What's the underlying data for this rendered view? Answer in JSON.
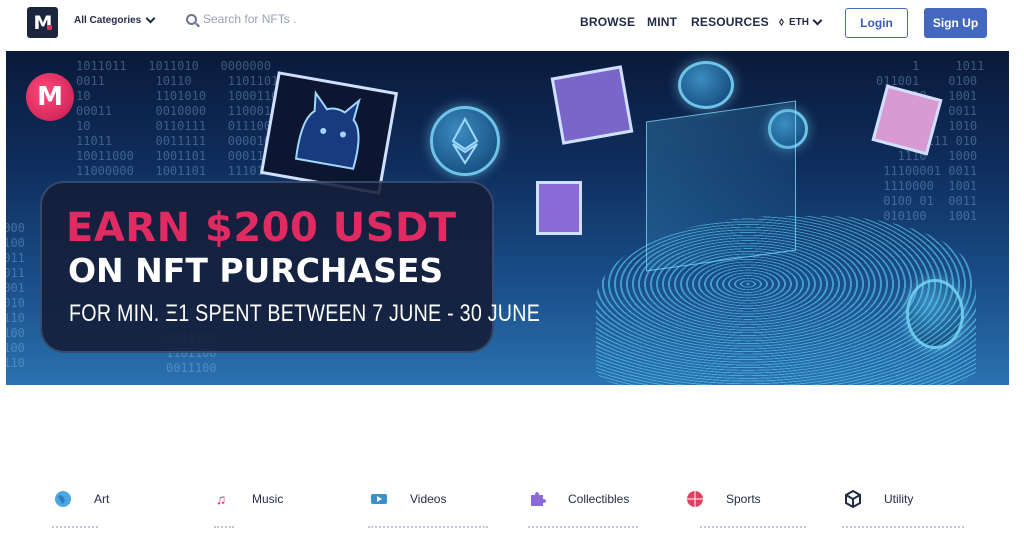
{
  "header": {
    "logo_letter": "M",
    "categories_label": "All Categories",
    "search_placeholder": "Search for NFTs .",
    "nav": [
      "BROWSE",
      "MINT",
      "RESOURCES"
    ],
    "currency_label": "ETH",
    "login_label": "Login",
    "signup_label": "Sign Up"
  },
  "banner": {
    "logo_letter": "M",
    "headline_1": "EARN $200 USDT",
    "headline_2": "ON NFT PURCHASES",
    "subline": "FOR MIN. Ξ1 SPENT BETWEEN 7 JUNE - 30 JUNE",
    "binary_text": "1011011\n0011\n10\n00011\n10\n11011\n10011000\n11000000\n01\n10\n0110101"
  },
  "categories": [
    {
      "label": "Art",
      "icon": "globe-icon"
    },
    {
      "label": "Music",
      "icon": "music-note-icon"
    },
    {
      "label": "Videos",
      "icon": "video-icon"
    },
    {
      "label": "Collectibles",
      "icon": "puzzle-icon"
    },
    {
      "label": "Sports",
      "icon": "basketball-icon"
    },
    {
      "label": "Utility",
      "icon": "cube-icon"
    }
  ],
  "colors": {
    "brand_dark": "#1c2540",
    "accent_pink": "#e02a62",
    "button_blue": "#4468bf"
  }
}
